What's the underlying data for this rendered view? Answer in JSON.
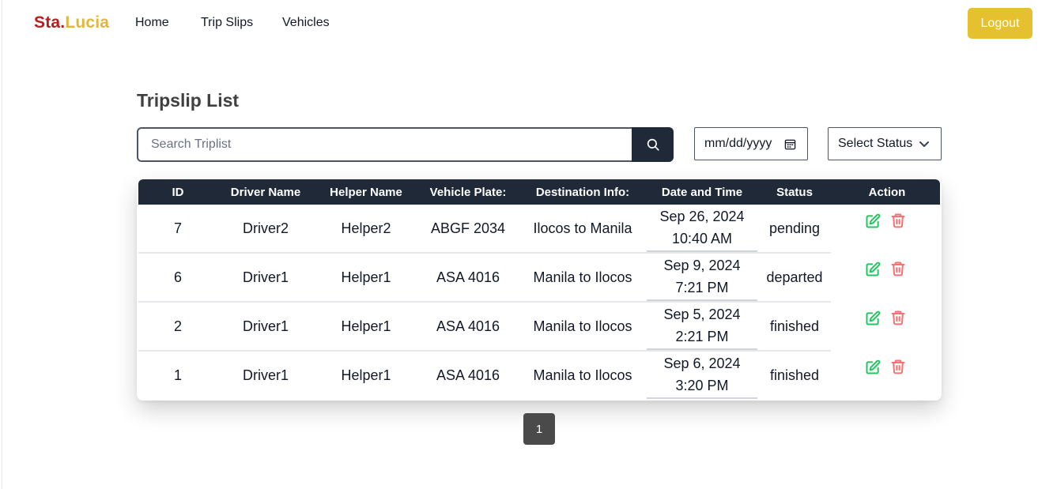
{
  "brand": {
    "part1": "Sta.",
    "part2": "Lucia"
  },
  "nav": {
    "home": "Home",
    "trip_slips": "Trip Slips",
    "vehicles": "Vehicles",
    "logout": "Logout"
  },
  "page": {
    "title": "Tripslip List"
  },
  "filters": {
    "search_placeholder": "Search Triplist",
    "date_placeholder": "mm/dd/yyyy",
    "status_selected": "Select Status"
  },
  "table": {
    "headers": [
      "ID",
      "Driver Name",
      "Helper Name",
      "Vehicle Plate:",
      "Destination Info:",
      "Date and Time",
      "Status",
      "Action"
    ],
    "rows": [
      {
        "id": "7",
        "driver": "Driver2",
        "helper": "Helper2",
        "plate": "ABGF 2034",
        "destination": "Ilocos to Manila",
        "date": "Sep 26, 2024",
        "time": "10:40 AM",
        "status": "pending"
      },
      {
        "id": "6",
        "driver": "Driver1",
        "helper": "Helper1",
        "plate": "ASA 4016",
        "destination": "Manila to Ilocos",
        "date": "Sep 9, 2024",
        "time": "7:21 PM",
        "status": "departed"
      },
      {
        "id": "2",
        "driver": "Driver1",
        "helper": "Helper1",
        "plate": "ASA 4016",
        "destination": "Manila to Ilocos",
        "date": "Sep 5, 2024",
        "time": "2:21 PM",
        "status": "finished"
      },
      {
        "id": "1",
        "driver": "Driver1",
        "helper": "Helper1",
        "plate": "ASA 4016",
        "destination": "Manila to Ilocos",
        "date": "Sep 6, 2024",
        "time": "3:20 PM",
        "status": "finished"
      }
    ]
  },
  "pagination": {
    "current": "1"
  },
  "icons": {
    "search": "search-icon",
    "calendar": "calendar-icon",
    "chevron": "chevron-down-icon",
    "edit": "edit-icon",
    "delete": "trash-icon"
  },
  "colors": {
    "brand_red": "#b91c1c",
    "brand_yellow": "#e3b53a",
    "logout_bg": "#e5c02f",
    "header_bg": "#1f2937",
    "edit_green": "#22c55e",
    "delete_red": "#f87171"
  }
}
